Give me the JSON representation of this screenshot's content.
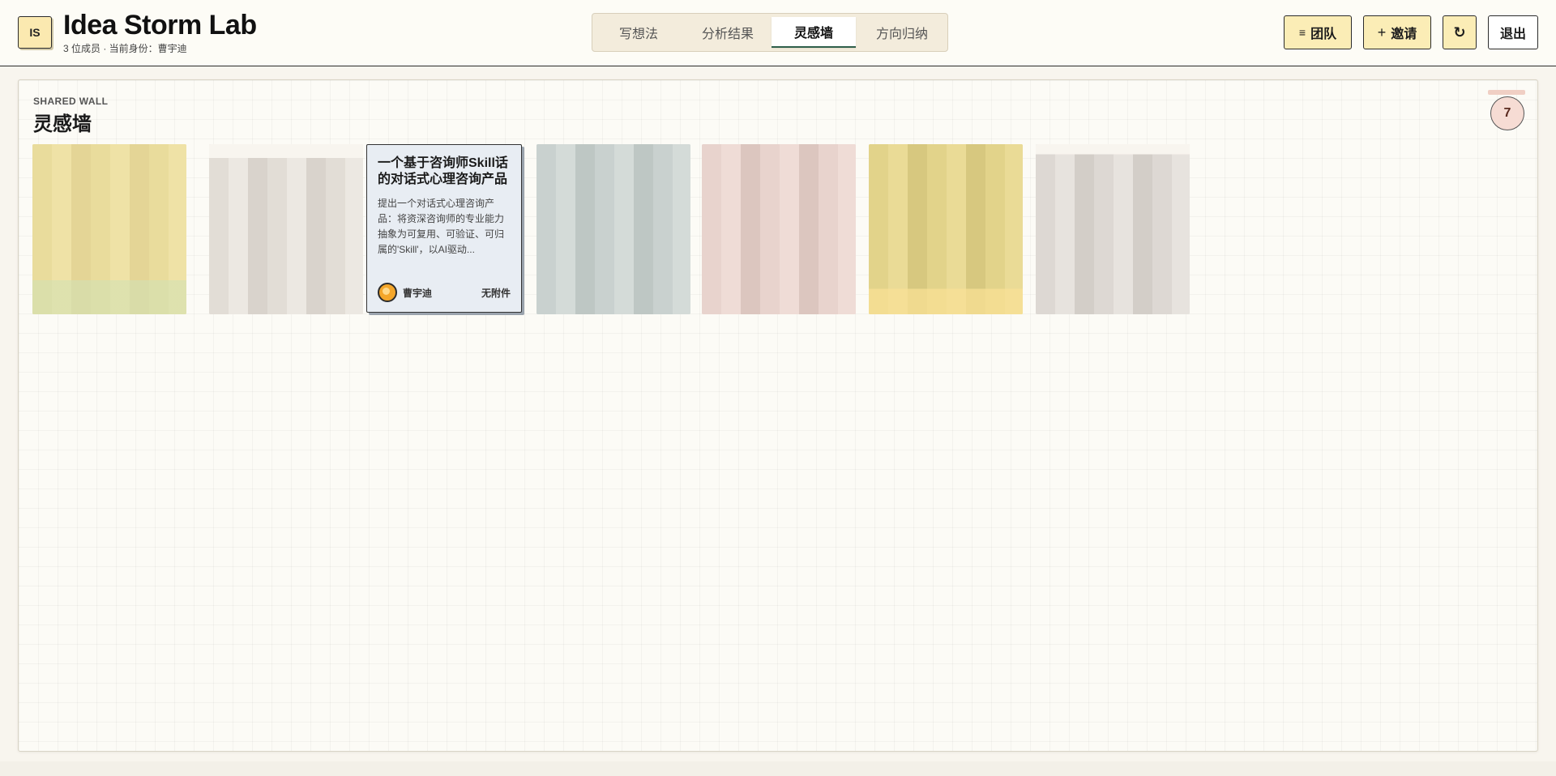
{
  "header": {
    "logo_text": "IS",
    "title": "Idea Storm Lab",
    "subtitle": "3 位成员 · 当前身份：曹宇迪",
    "tabs": [
      {
        "label": "写想法",
        "active": false
      },
      {
        "label": "分析结果",
        "active": false
      },
      {
        "label": "灵感墙",
        "active": true
      },
      {
        "label": "方向归纳",
        "active": false
      }
    ],
    "buttons": {
      "team_icon": "≡",
      "team_label": "团队",
      "invite_icon": "+",
      "invite_label": "邀请",
      "refresh_icon": "↻",
      "logout_label": "退出"
    }
  },
  "wall": {
    "eyebrow": "SHARED WALL",
    "title": "灵感墙",
    "count": "7",
    "featured_card": {
      "title": "一个基于咨询师Skill话的对话式心理咨询产品",
      "body": "提出一个对话式心理咨询产品：将资深咨询师的专业能力抽象为可复用、可验证、可归属的'Skill'，以AI驱动...",
      "author": "曹宇迪",
      "attachment": "无附件"
    }
  },
  "colors": {
    "accent": "#2f5f4a",
    "button_yellow": "#fbedb6",
    "featured_card_bg": "#e8edf3",
    "badge_bg": "#f6dcd4"
  }
}
